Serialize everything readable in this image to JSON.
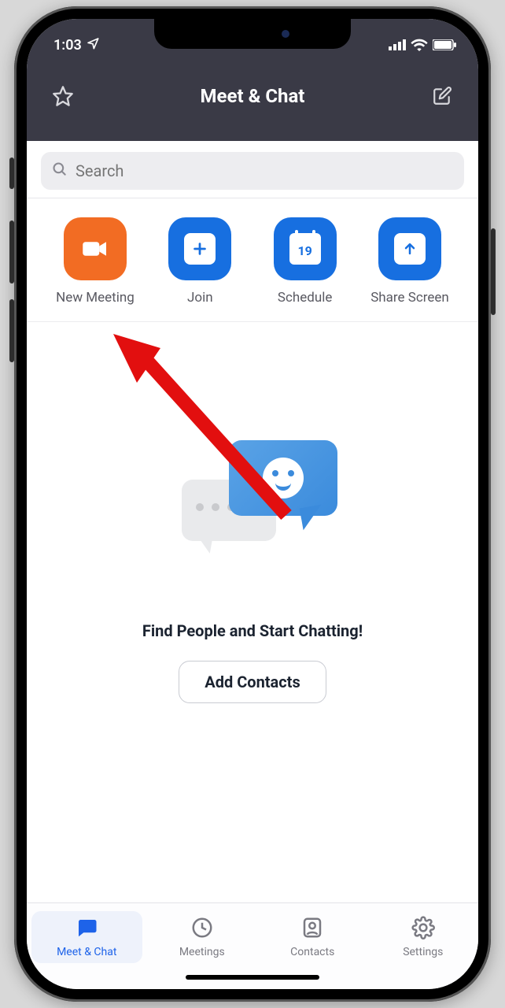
{
  "status": {
    "time": "1:03"
  },
  "header": {
    "title": "Meet & Chat"
  },
  "search": {
    "placeholder": "Search"
  },
  "actions": {
    "new_meeting": "New Meeting",
    "join": "Join",
    "schedule": "Schedule",
    "schedule_day": "19",
    "share_screen": "Share Screen"
  },
  "empty": {
    "headline": "Find People and Start Chatting!",
    "add_contacts": "Add Contacts"
  },
  "tabs": {
    "meet_chat": "Meet & Chat",
    "meetings": "Meetings",
    "contacts": "Contacts",
    "settings": "Settings"
  }
}
